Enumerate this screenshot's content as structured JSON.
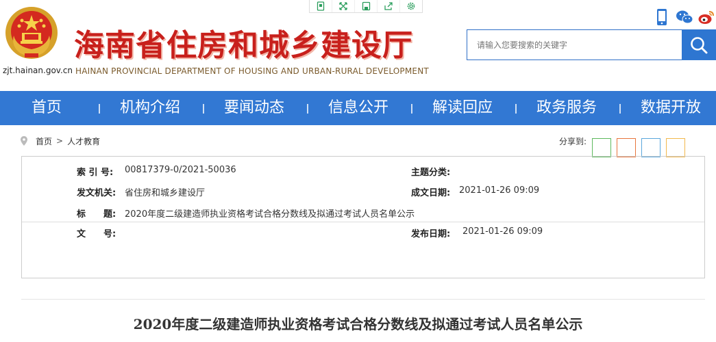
{
  "header": {
    "domain": "zjt.hainan.gov.cn",
    "title": "海南省住房和城乡建设厅",
    "subtitle": "HAINAN PROVINCIAL DEPARTMENT OF HOUSING AND URBAN-RURAL DEVELOPMENT",
    "toolbar": [
      "tablet-icon",
      "fullscreen-icon",
      "save-icon",
      "share-out-icon",
      "settings-icon"
    ],
    "social": [
      "mobile-icon",
      "wechat-icon",
      "weibo-icon"
    ]
  },
  "search": {
    "placeholder": "请输入您要搜索的关键字"
  },
  "nav": {
    "items": [
      "首页",
      "机构介绍",
      "要闻动态",
      "信息公开",
      "解读回应",
      "政务服务",
      "数据开放"
    ]
  },
  "breadcrumb": {
    "home": "首页",
    "separator": ">",
    "current": "人才教育"
  },
  "share": {
    "label": "分享到:",
    "colors": [
      "#5cb85c",
      "#e8743b",
      "#5aa6dc",
      "#f2b84b"
    ]
  },
  "info": {
    "index_label": "索 引 号:",
    "index_value": "00817379-0/2021-50036",
    "topic_label": "主题分类:",
    "topic_value": "",
    "issuer_label": "发文机关:",
    "issuer_value": "省住房和城乡建设厅",
    "created_label": "成文日期:",
    "created_value": "2021-01-26 09:09",
    "title_label": "标　　题:",
    "title_value": "2020年度二级建造师执业资格考试合格分数线及拟通过考试人员名单公示",
    "docno_label": "文　　号:",
    "docno_value": "",
    "published_label": "发布日期:",
    "published_value": "2021-01-26 09:09"
  },
  "article": {
    "title": "2020年度二级建造师执业资格考试合格分数线及拟通过考试人员名单公示"
  },
  "colors": {
    "brand_red": "#c8201c",
    "nav_blue": "#3278d3",
    "search_blue": "#2e76d1"
  }
}
